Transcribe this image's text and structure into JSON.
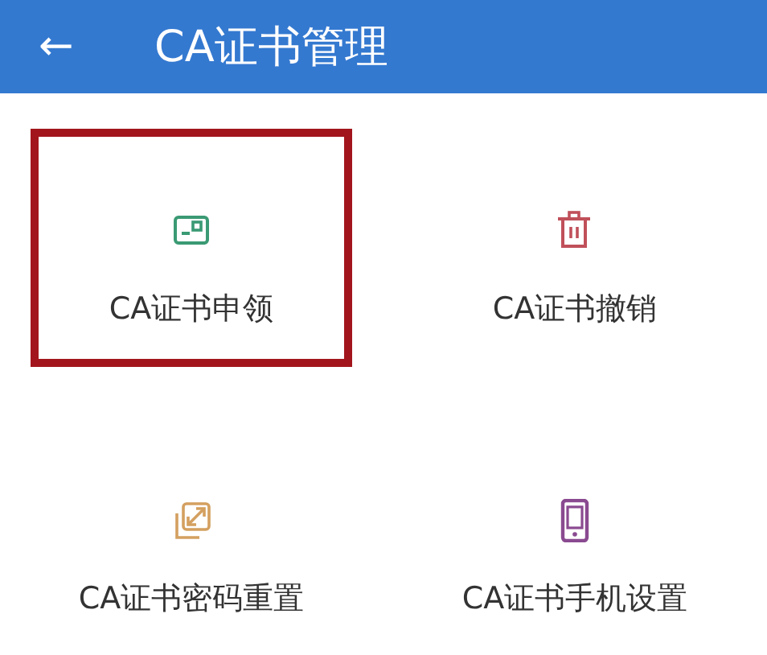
{
  "header": {
    "back_icon": "←",
    "title": "CA证书管理"
  },
  "items": [
    {
      "label": "CA证书申领",
      "kind": "card",
      "color": "#3a9a74",
      "highlighted": true
    },
    {
      "label": "CA证书撤销",
      "kind": "trash",
      "color": "#c0505a",
      "highlighted": false
    },
    {
      "label": "CA证书密码重置",
      "kind": "swap",
      "color": "#d4a060",
      "highlighted": false
    },
    {
      "label": "CA证书手机设置",
      "kind": "phone",
      "color": "#8a4a90",
      "highlighted": false
    }
  ]
}
